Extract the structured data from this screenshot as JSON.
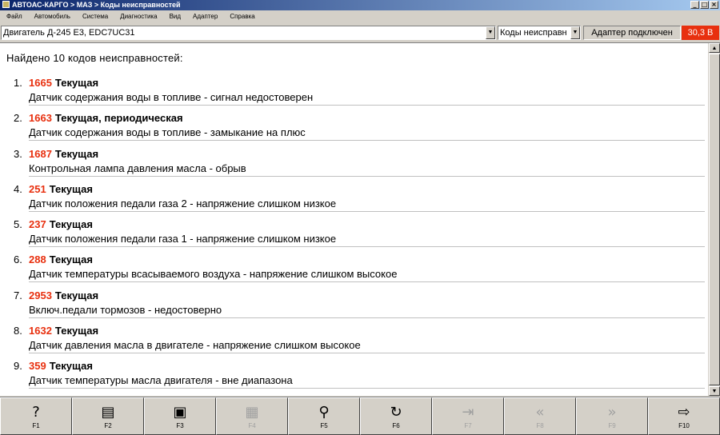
{
  "window": {
    "title": "АВТОАС-КАРГО > МАЗ > Коды неисправностей",
    "controls": [
      "_",
      "□",
      "×"
    ]
  },
  "menu": [
    "Файл",
    "Автомобиль",
    "Система",
    "Диагностика",
    "Вид",
    "Адаптер",
    "Справка"
  ],
  "selector": {
    "engine": "Двигатель Д-245 Е3, EDC7UC31",
    "mode": "Коды неисправн",
    "adapter_status": "Адаптер подключен",
    "voltage": "30,3 В"
  },
  "summary": "Найдено 10 кодов неисправностей:",
  "faults": [
    {
      "num": "1.",
      "code": "1665",
      "status": "Текущая",
      "desc": "Датчик содержания воды в топливе - сигнал недостоверен"
    },
    {
      "num": "2.",
      "code": "1663",
      "status": "Текущая, периодическая",
      "desc": "Датчик содержания воды в топливе - замыкание на плюс"
    },
    {
      "num": "3.",
      "code": "1687",
      "status": "Текущая",
      "desc": "Контрольная лампа давления масла - обрыв"
    },
    {
      "num": "4.",
      "code": "251",
      "status": "Текущая",
      "desc": "Датчик положения педали газа 2 - напряжение слишком низкое"
    },
    {
      "num": "5.",
      "code": "237",
      "status": "Текущая",
      "desc": "Датчик положения педали газа 1 - напряжение слишком низкое"
    },
    {
      "num": "6.",
      "code": "288",
      "status": "Текущая",
      "desc": "Датчик температуры всасываемого воздуха - напряжение слишком высокое"
    },
    {
      "num": "7.",
      "code": "2953",
      "status": "Текущая",
      "desc": "Включ.педали тормозов - недостоверно"
    },
    {
      "num": "8.",
      "code": "1632",
      "status": "Текущая",
      "desc": "Датчик давления масла в двигателе - напряжение слишком высокое"
    },
    {
      "num": "9.",
      "code": "359",
      "status": "Текущая",
      "desc": "Датчик температуры масла двигателя - вне диапазона"
    }
  ],
  "fkeys": [
    {
      "label": "F1",
      "icon": "help-icon",
      "glyph": "?",
      "enabled": true
    },
    {
      "label": "F2",
      "icon": "print-icon",
      "glyph": "▤",
      "enabled": true
    },
    {
      "label": "F3",
      "icon": "save-icon",
      "glyph": "▣",
      "enabled": true
    },
    {
      "label": "F4",
      "icon": "table-icon",
      "glyph": "▦",
      "enabled": false
    },
    {
      "label": "F5",
      "icon": "clear-broom-icon",
      "glyph": "⚲",
      "enabled": true
    },
    {
      "label": "F6",
      "icon": "refresh-icon",
      "glyph": "↻",
      "enabled": true
    },
    {
      "label": "F7",
      "icon": "import-icon",
      "glyph": "⇥",
      "enabled": false
    },
    {
      "label": "F8",
      "icon": "rewind-icon",
      "glyph": "«",
      "enabled": false
    },
    {
      "label": "F9",
      "icon": "forward-icon",
      "glyph": "»",
      "enabled": false
    },
    {
      "label": "F10",
      "icon": "exit-icon",
      "glyph": "⇨",
      "enabled": true
    }
  ]
}
